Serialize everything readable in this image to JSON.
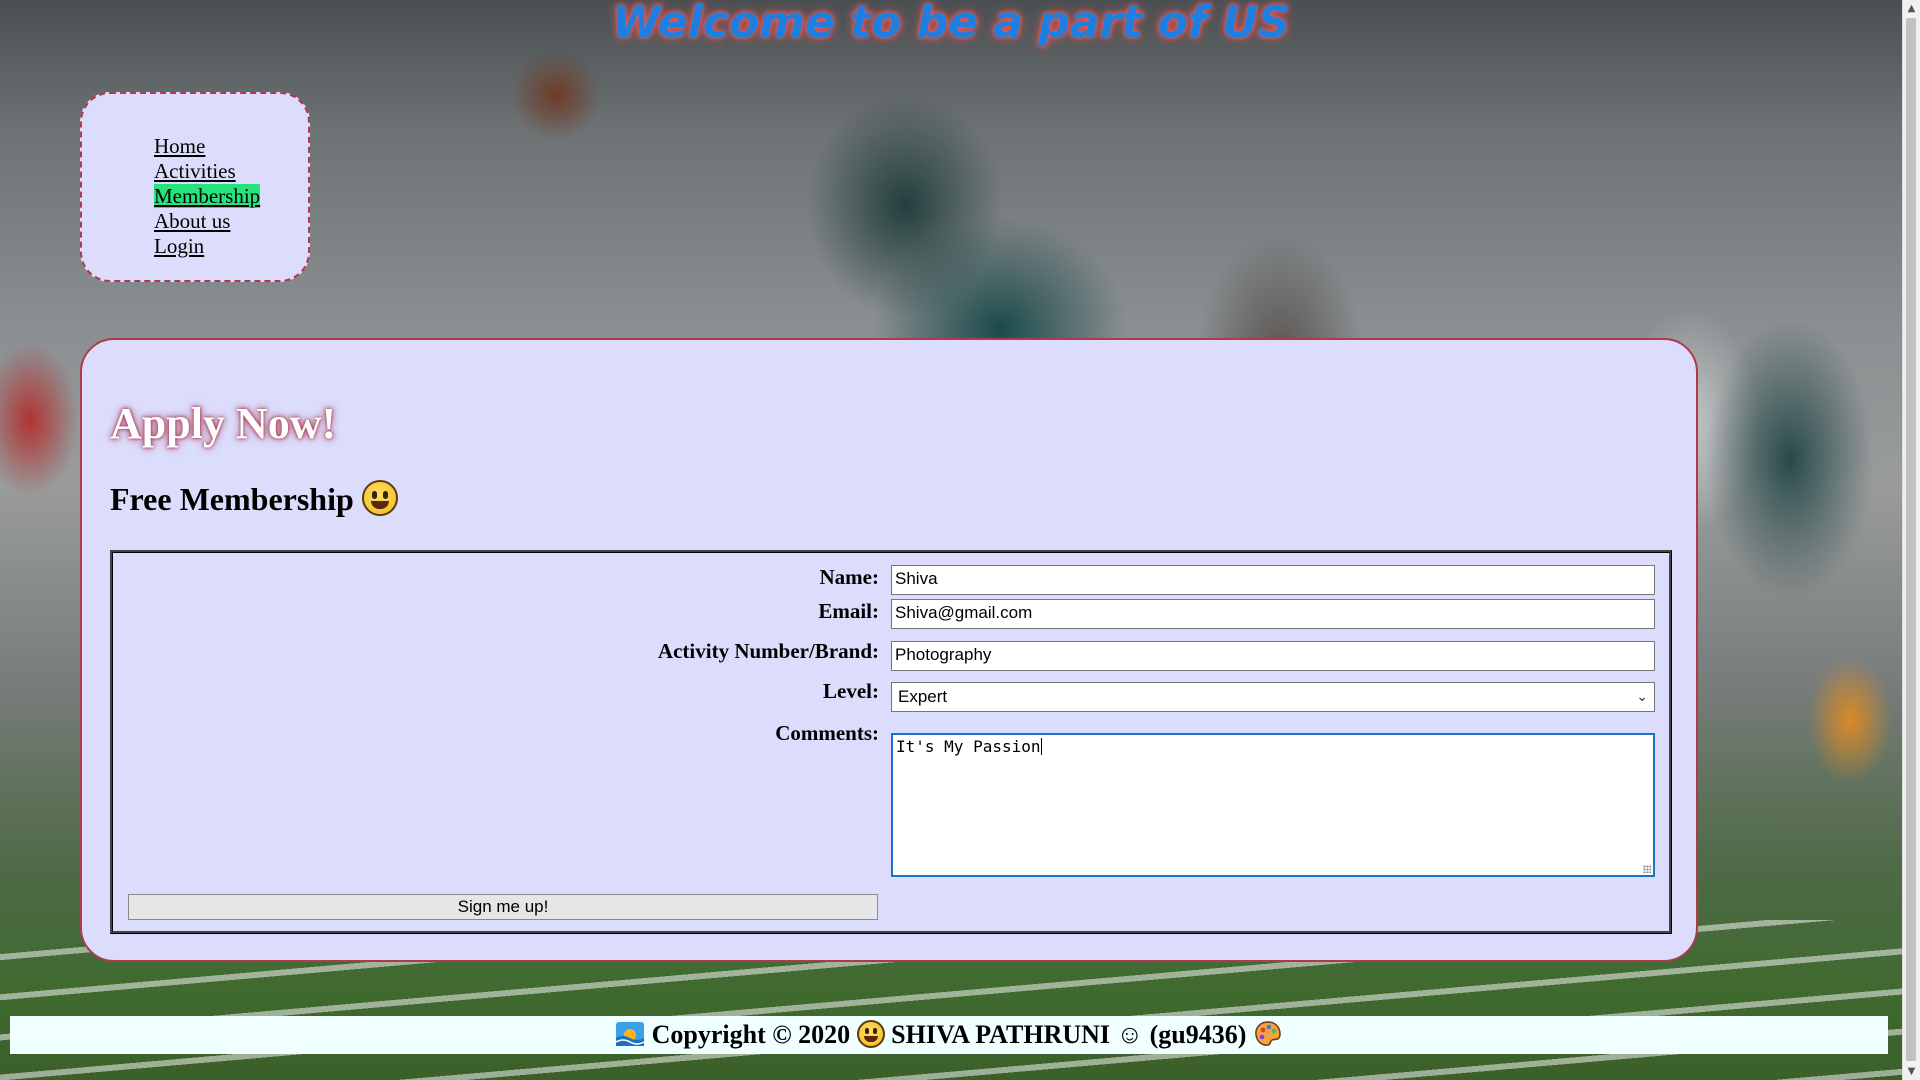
{
  "banner": {
    "title": "Welcome to be a part of US"
  },
  "nav": {
    "items": [
      {
        "label": "Home",
        "active": false
      },
      {
        "label": "Activities",
        "active": false
      },
      {
        "label": "Membership",
        "active": true
      },
      {
        "label": "About us",
        "active": false
      },
      {
        "label": "Login",
        "active": false
      }
    ]
  },
  "main": {
    "apply_title": "Apply Now!",
    "membership_title": "Free Membership",
    "membership_icon": "grinning-face-icon"
  },
  "form": {
    "name_label": "Name:",
    "name_value": "Shiva",
    "email_label": "Email:",
    "email_value": "Shiva@gmail.com",
    "activity_label": "Activity Number/Brand:",
    "activity_value": "Photography",
    "level_label": "Level:",
    "level_value": "Expert",
    "comments_label": "Comments:",
    "comments_value": "It's My Passion",
    "submit_label": "Sign me up!"
  },
  "footer": {
    "copyright": "Copyright © 2020",
    "author": "SHIVA PATHRUNI",
    "smile": "☺",
    "handle": "(gu9436)",
    "icons": [
      "sunrise-icon",
      "grinning-face-icon",
      "palette-icon"
    ]
  },
  "colors": {
    "title_blue": "#1e7fe0",
    "panel_bg": "#dcdcfc",
    "panel_border": "#b03a4d",
    "active_nav_bg": "#27e37b",
    "footer_bg": "#f0ffff"
  }
}
